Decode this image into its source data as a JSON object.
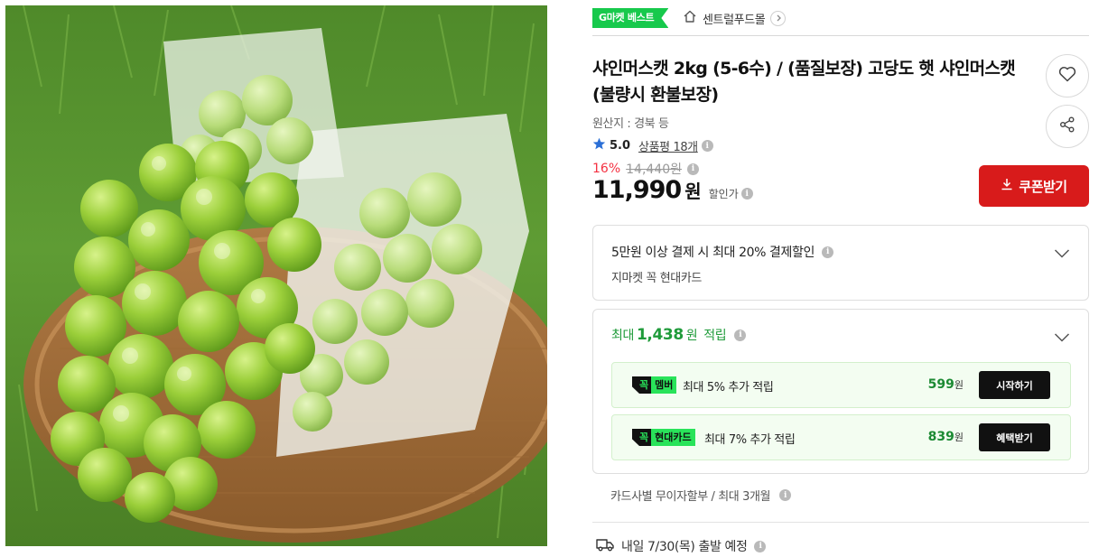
{
  "header": {
    "badge": "G마켓 베스트",
    "store_name": "센트럴푸드몰"
  },
  "product": {
    "title": "샤인머스캣 2kg (5-6수) / (품질보장) 고당도 햇 샤인머스캣 (불량시 환불보장)",
    "origin": "원산지 : 경북 등",
    "rating": "5.0",
    "review_label": "상품평 18개",
    "discount_rate": "16%",
    "original_price": "14,440원",
    "sale_price": "11,990",
    "sale_price_unit": "원",
    "sale_price_label": "할인가"
  },
  "actions": {
    "coupon_label": "쿠폰받기"
  },
  "card_benefit": {
    "headline": "5만원 이상 결제 시 최대 20% 결제할인",
    "subline": "지마켓 꼭 현대카드"
  },
  "points": {
    "prefix": "최대",
    "amount": "1,438",
    "unit": "원",
    "suffix": "적립",
    "promos": [
      {
        "tag_prefix": "꼭",
        "tag_name": "멤버",
        "text": "최대 5% 추가 적립",
        "won": "599",
        "won_unit": "원",
        "action": "시작하기"
      },
      {
        "tag_prefix": "꼭",
        "tag_name": "현대카드",
        "text": "최대 7% 추가 적립",
        "won": "839",
        "won_unit": "원",
        "action": "혜택받기"
      }
    ]
  },
  "installment": "카드사별 무이자할부 / 최대 3개월",
  "delivery": "내일 7/30(목) 출발 예정",
  "icons": {
    "store": "home-icon",
    "favorite": "heart-icon",
    "share": "share-icon",
    "rating": "star-icon",
    "coupon": "download-icon",
    "delivery": "truck-icon",
    "info": "info-icon"
  },
  "colors": {
    "brand_green": "#17c94c",
    "coupon_red": "#d81b1b",
    "discount_red": "#f43142",
    "points_green": "#1f9b3a",
    "star_blue": "#2b6fd6"
  }
}
